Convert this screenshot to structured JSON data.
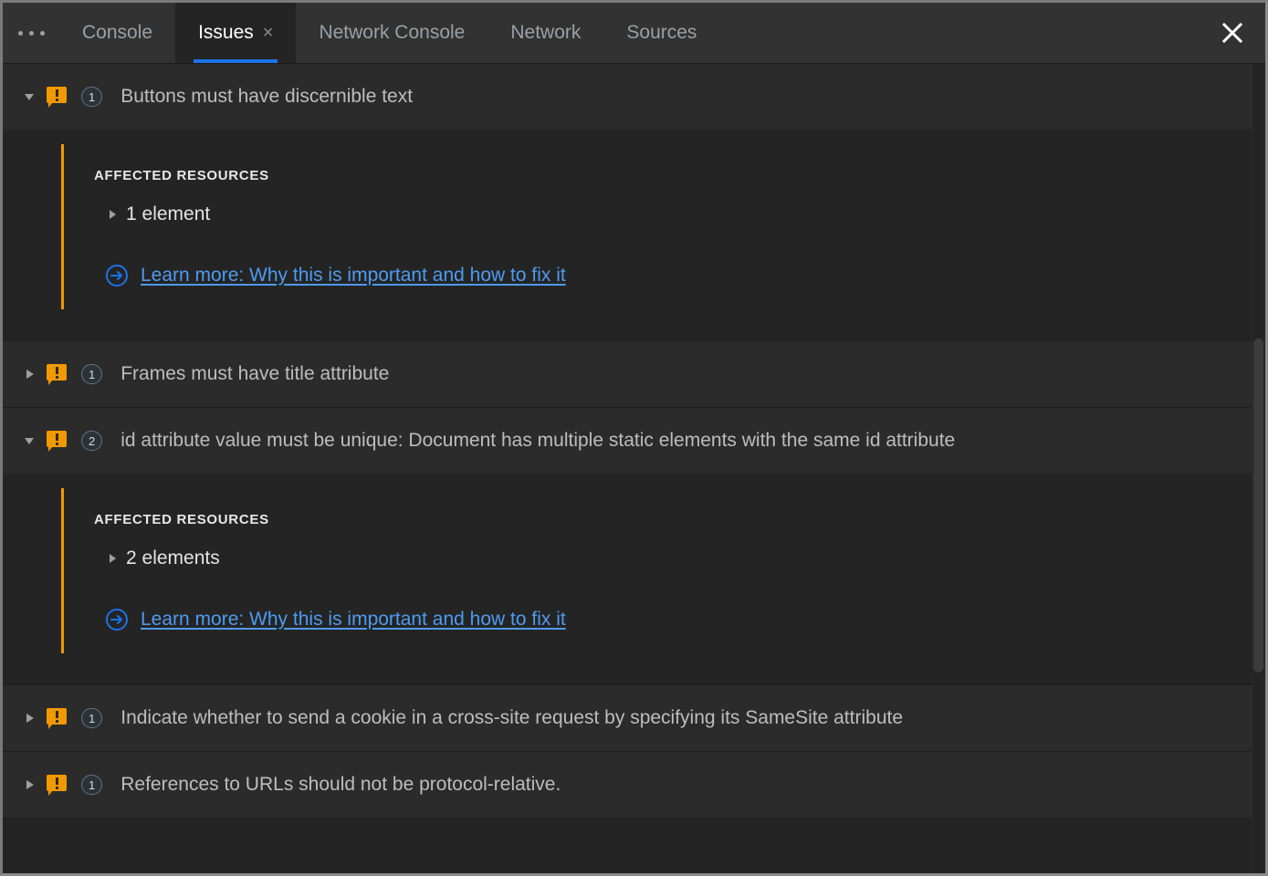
{
  "window": {
    "accent_orange": "#f29900",
    "accent_blue": "#1a73e8",
    "link_blue": "#4d9bf0",
    "background": "#242424",
    "row_background": "#2b2b2b"
  },
  "tabbar": {
    "overflow_menu_label": "More tools",
    "close_panel_label": "Close",
    "tabs": [
      {
        "label": "Console",
        "active": false,
        "closable": false
      },
      {
        "label": "Issues",
        "active": true,
        "closable": true,
        "close_label": "×"
      },
      {
        "label": "Network Console",
        "active": false,
        "closable": false
      },
      {
        "label": "Network",
        "active": false,
        "closable": false
      },
      {
        "label": "Sources",
        "active": false,
        "closable": false
      }
    ]
  },
  "labels": {
    "affected_resources": "AFFECTED RESOURCES",
    "learn_more": "Learn more: Why this is important and how to fix it"
  },
  "issues": [
    {
      "title": "Buttons must have discernible text",
      "count": "1",
      "severity": "warning",
      "expanded": true,
      "affected_resources_label": "AFFECTED RESOURCES",
      "resource_text": "1 element",
      "learn_more": "Learn more: Why this is important and how to fix it"
    },
    {
      "title": "Frames must have title attribute",
      "count": "1",
      "severity": "warning",
      "expanded": false
    },
    {
      "title": "id attribute value must be unique: Document has multiple static elements with the same id attribute",
      "count": "2",
      "severity": "warning",
      "expanded": true,
      "affected_resources_label": "AFFECTED RESOURCES",
      "resource_text": "2 elements",
      "learn_more": "Learn more: Why this is important and how to fix it"
    },
    {
      "title": "Indicate whether to send a cookie in a cross-site request by specifying its SameSite attribute",
      "count": "1",
      "severity": "warning",
      "expanded": false
    },
    {
      "title": "References to URLs should not be protocol-relative.",
      "count": "1",
      "severity": "warning",
      "expanded": false
    }
  ]
}
